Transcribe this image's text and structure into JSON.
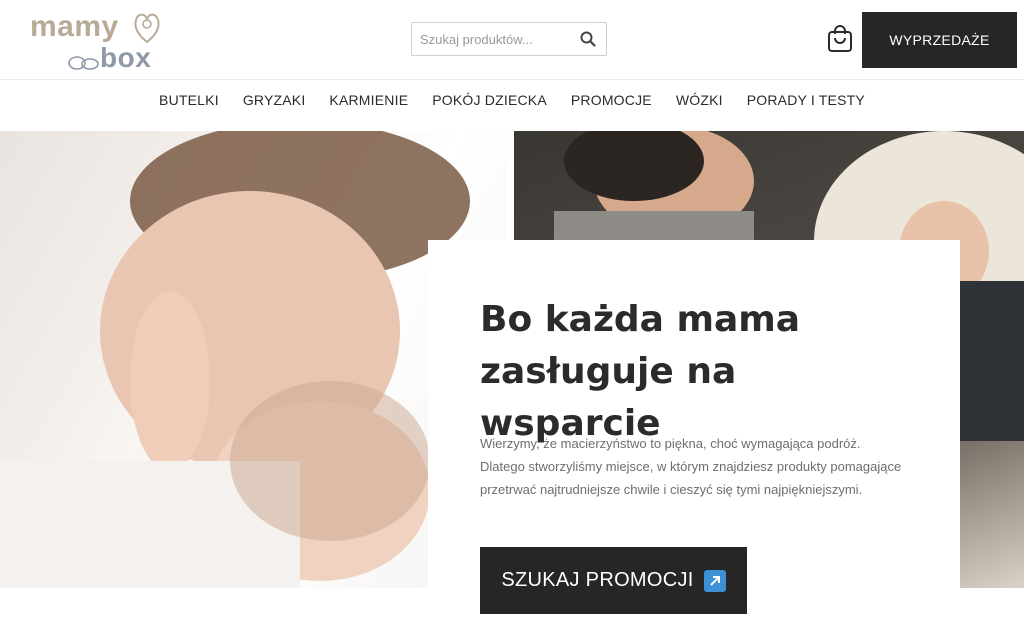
{
  "brand": {
    "word1": "mamy",
    "word2": "box"
  },
  "search": {
    "placeholder": "Szukaj produktów..."
  },
  "header": {
    "sale_label": "WYPRZEDAŻE"
  },
  "nav": {
    "items": [
      {
        "label": "BUTELKI"
      },
      {
        "label": "GRYZAKI"
      },
      {
        "label": "KARMIENIE"
      },
      {
        "label": "POKÓJ DZIECKA"
      },
      {
        "label": "PROMOCJE"
      },
      {
        "label": "WÓZKI"
      },
      {
        "label": "PORADY I TESTY"
      }
    ]
  },
  "hero": {
    "title_line1": "Bo każda mama",
    "title_line2": "zasługuje na wsparcie",
    "text_line1": "Wierzymy, że macierzyństwo to piękna, choć wymagająca podróż.",
    "text_line2": "Dlatego stworzyliśmy miejsce, w którym znajdziesz produkty pomagające",
    "text_line3": "przetrwać najtrudniejsze chwile i cieszyć się tymi najpiękniejszymi.",
    "cta_label": "SZUKAJ PROMOCJI"
  },
  "icons": {
    "search": "search-icon",
    "cart": "shopping-bag-icon",
    "arrow": "arrow-up-right-icon"
  },
  "colors": {
    "brand_beige": "#b9aa98",
    "brand_gray": "#8f99a8",
    "dark_button": "#262626",
    "arrow_blue": "#3d8fd6"
  }
}
